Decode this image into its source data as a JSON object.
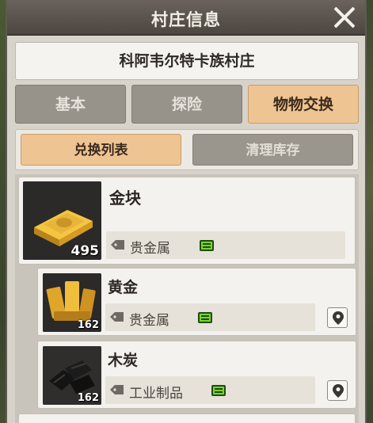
{
  "window": {
    "title": "村庄信息"
  },
  "village": {
    "name": "科阿韦尔特卡族村庄"
  },
  "tabs": [
    {
      "label": "基本",
      "active": false
    },
    {
      "label": "探险",
      "active": false
    },
    {
      "label": "物物交换",
      "active": true
    }
  ],
  "subtabs": [
    {
      "label": "兑换列表",
      "active": true
    },
    {
      "label": "清理库存",
      "active": false
    }
  ],
  "items": [
    {
      "name": "金块",
      "quantity": "495",
      "category": "贵金属",
      "icon": "gold-bar-icon"
    },
    {
      "name": "黄金",
      "quantity": "162",
      "category": "贵金属",
      "icon": "gold-bars-icon"
    },
    {
      "name": "木炭",
      "quantity": "162",
      "category": "工业制品",
      "icon": "charcoal-icon"
    }
  ],
  "colors": {
    "active_tab": "#efc493",
    "inactive_tab": "#97928a",
    "titlebar": "#4d4741",
    "money_icon": "#7bd42a"
  }
}
